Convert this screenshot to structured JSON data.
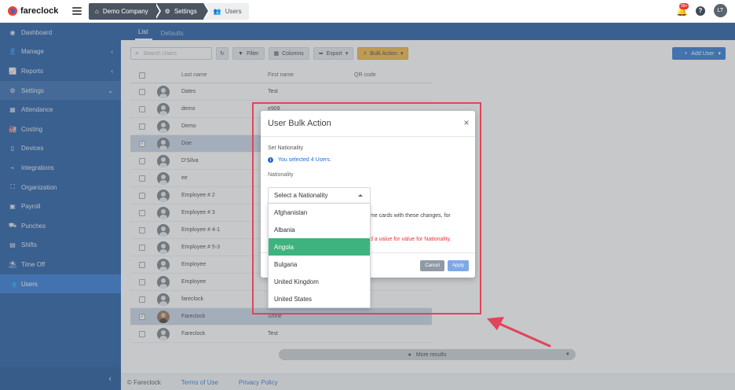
{
  "app": {
    "logo_text": "fareclock",
    "breadcrumbs": [
      "Demo Company",
      "Settings",
      "Users"
    ],
    "notifications_badge": "99+",
    "help_label": "?",
    "user_initials": "LT"
  },
  "sidebar": {
    "items": [
      {
        "label": "Dashboard",
        "icon": "dashboard-icon"
      },
      {
        "label": "Manage",
        "icon": "person-icon",
        "chevron": "‹"
      },
      {
        "label": "Reports",
        "icon": "chart-icon",
        "chevron": "‹"
      },
      {
        "label": "Settings",
        "icon": "gear-icon",
        "chevron": "⌄"
      },
      {
        "label": "Attendance",
        "icon": "grid-icon"
      },
      {
        "label": "Costing",
        "icon": "factory-icon"
      },
      {
        "label": "Devices",
        "icon": "device-icon"
      },
      {
        "label": "Integrations",
        "icon": "plug-icon"
      },
      {
        "label": "Organization",
        "icon": "org-icon"
      },
      {
        "label": "Payroll",
        "icon": "money-icon"
      },
      {
        "label": "Punches",
        "icon": "car-icon"
      },
      {
        "label": "Shifts",
        "icon": "calendar-icon"
      },
      {
        "label": "Time Off",
        "icon": "beach-icon"
      },
      {
        "label": "Users",
        "icon": "users-icon"
      }
    ],
    "collapse_label": "‹"
  },
  "main": {
    "tabs": [
      "List",
      "Defaults"
    ],
    "search_placeholder": "Search Users",
    "toolbar": {
      "refresh_label": "↻",
      "filter_label": "Filter",
      "columns_label": "Columns",
      "export_label": "Export",
      "bulk_label": "Bulk Action",
      "add_user_label": "Add User"
    },
    "table": {
      "headers": [
        "Last name",
        "First name",
        "QR code"
      ],
      "rows": [
        {
          "last": "Dates",
          "first": "Test",
          "selected": false,
          "photo": false
        },
        {
          "last": "demo",
          "first": "e909",
          "selected": false,
          "photo": false
        },
        {
          "last": "Demo",
          "first": "",
          "selected": false,
          "photo": false
        },
        {
          "last": "Doe",
          "first": "",
          "selected": true,
          "photo": false
        },
        {
          "last": "D'Silva",
          "first": "",
          "selected": false,
          "photo": false
        },
        {
          "last": "ee",
          "first": "",
          "selected": false,
          "photo": false
        },
        {
          "last": "Employee # 2",
          "first": "",
          "selected": false,
          "photo": false
        },
        {
          "last": "Employee # 3",
          "first": "",
          "selected": false,
          "photo": false
        },
        {
          "last": "Employee # 4-1",
          "first": "",
          "selected": false,
          "photo": false
        },
        {
          "last": "Employee # 5-3",
          "first": "",
          "selected": false,
          "photo": false
        },
        {
          "last": "Employee",
          "first": "",
          "selected": false,
          "photo": false
        },
        {
          "last": "Employee",
          "first": "",
          "selected": false,
          "photo": false
        },
        {
          "last": "fareclock",
          "first": "",
          "selected": false,
          "photo": false
        },
        {
          "last": "Fareclock",
          "first": "Shine",
          "selected": true,
          "photo": true
        },
        {
          "last": "Fareclock",
          "first": "Test",
          "selected": false,
          "photo": false
        }
      ]
    },
    "more_results": "More results",
    "footer": {
      "copyright": "© Fareclock",
      "terms": "Terms of Use",
      "privacy": "Privacy Policy"
    }
  },
  "modal": {
    "title": "User Bulk Action",
    "close": "×",
    "section": "Set Nationality",
    "info": "You selected 4 Users.",
    "field_label": "Nationality",
    "partial_text": "me cards with these changes, for",
    "error_text": "d a value for value for Nationality.",
    "cancel": "Cancel",
    "apply": "Apply",
    "select_placeholder": "Select a Nationality",
    "options": [
      "Afghanistan",
      "Albania",
      "Angola",
      "Bulgaria",
      "United Kingdom",
      "United States"
    ],
    "highlighted_option": "Angola"
  },
  "colors": {
    "sidebar": "#0f4d9c",
    "accent": "#1e6dcf",
    "highlight": "#3fb37f",
    "annotation": "#e0455a"
  }
}
